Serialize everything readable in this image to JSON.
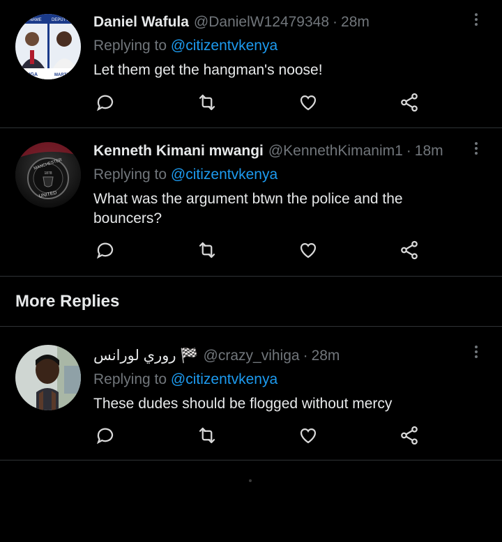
{
  "replies": [
    {
      "name": "Daniel Wafula",
      "handle": "@DanielW12479348",
      "separator": "·",
      "time": "28m",
      "replying_prefix": "Replying to",
      "replying_to": "@citizentvkenya",
      "text": "Let them get the hangman's noose!"
    },
    {
      "name": "Kenneth Kimani mwangi",
      "handle": "@KennethKimanim1",
      "separator": "·",
      "time": "18m",
      "replying_prefix": "Replying to",
      "replying_to": "@citizentvkenya",
      "text": "What was the argument btwn the police and the bouncers?"
    }
  ],
  "section_title": "More Replies",
  "more_replies": [
    {
      "name": "روري لورانس 🏁",
      "handle": "@crazy_vihiga",
      "separator": "·",
      "time": "28m",
      "replying_prefix": "Replying to",
      "replying_to": "@citizentvkenya",
      "text": "These dudes should be flogged without mercy"
    }
  ],
  "avatar_labels": {
    "poster_top_left": "AND NAME",
    "poster_top_right": "DEPUTY P",
    "poster_bottom_left": "ODINGA",
    "poster_bottom_right": "MARTHA",
    "crest_top": "MANCHESTER",
    "crest_bottom": "UNITED",
    "crest_year": "1878"
  },
  "icons": [
    "reply-icon",
    "retweet-icon",
    "like-icon",
    "share-icon",
    "more-options-icon"
  ],
  "colors": {
    "background": "#000000",
    "text": "#e7e9ea",
    "muted": "#71767b",
    "link": "#1d9bf0",
    "divider": "#2f3336"
  }
}
